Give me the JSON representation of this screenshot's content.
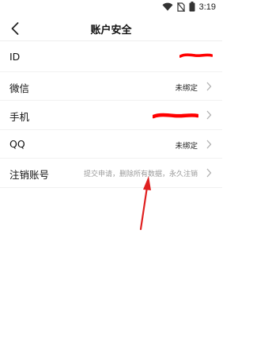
{
  "status_bar": {
    "time": "3:19",
    "icons": [
      "wifi-icon",
      "no-sim-icon",
      "battery-icon"
    ]
  },
  "header": {
    "title": "账户安全",
    "back_icon": "chevron-left-icon"
  },
  "rows": [
    {
      "label": "ID",
      "value": "",
      "redacted": true,
      "has_chevron": false
    },
    {
      "label": "微信",
      "value": "未绑定",
      "redacted": false,
      "has_chevron": true
    },
    {
      "label": "手机",
      "value": "",
      "redacted": true,
      "has_chevron": true
    },
    {
      "label": "QQ",
      "value": "未绑定",
      "redacted": false,
      "has_chevron": true
    },
    {
      "label": "注销账号",
      "value": "提交申请，删除所有数据，永久注销",
      "redacted": false,
      "has_chevron": true
    }
  ],
  "colors": {
    "redaction": "#ff0000",
    "arrow": "#e02020",
    "divider": "#f1f1f1",
    "muted_text": "#9a9a9a"
  }
}
